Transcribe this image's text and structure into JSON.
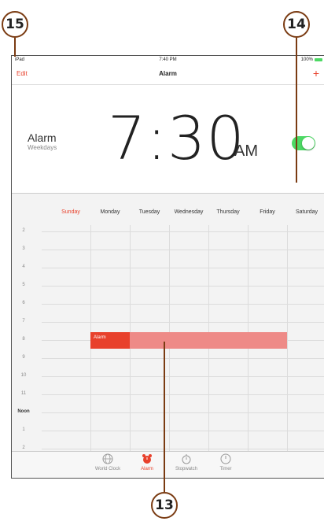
{
  "callouts": {
    "c15": "15",
    "c14": "14",
    "c13": "13"
  },
  "status": {
    "carrier": "iPad",
    "time": "7:40 PM",
    "battery": "100%"
  },
  "nav": {
    "edit": "Edit",
    "title": "Alarm",
    "add": "+"
  },
  "alarm": {
    "label": "Alarm",
    "repeat": "Weekdays",
    "time": "7:30",
    "ampm": "AM",
    "enabled": true
  },
  "week": {
    "days": [
      "Sunday",
      "Monday",
      "Tuesday",
      "Wednesday",
      "Thursday",
      "Friday",
      "Saturday"
    ],
    "today": "Sunday",
    "hours": [
      "2",
      "3",
      "4",
      "5",
      "6",
      "7",
      "8",
      "9",
      "10",
      "11",
      "Noon",
      "1",
      "2"
    ],
    "event_label": "Alarm"
  },
  "tabs": [
    {
      "label": "World Clock",
      "icon": "globe-icon"
    },
    {
      "label": "Alarm",
      "icon": "alarm-clock-icon",
      "active": true
    },
    {
      "label": "Stopwatch",
      "icon": "stopwatch-icon"
    },
    {
      "label": "Timer",
      "icon": "timer-icon"
    }
  ],
  "colors": {
    "accent": "#e8412c",
    "toggle_on": "#4cd964",
    "event_fill": "#ee8a87",
    "callout_border": "#7a3b12"
  }
}
